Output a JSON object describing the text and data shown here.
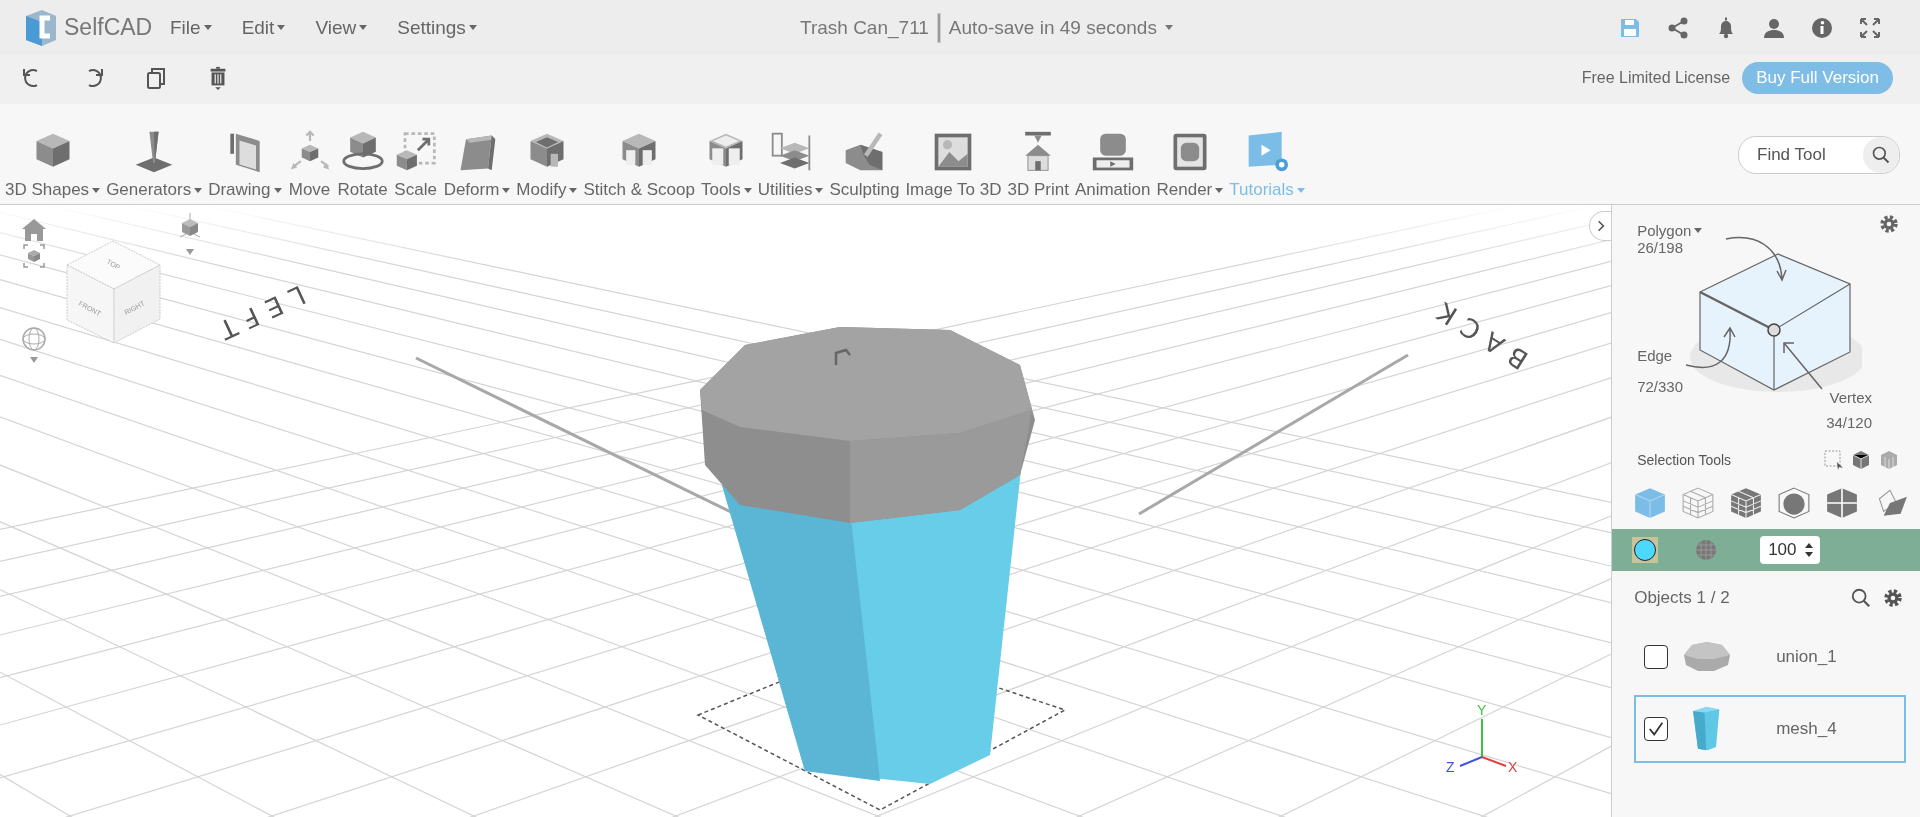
{
  "app": {
    "name": "SelfCAD"
  },
  "menus": [
    {
      "label": "File"
    },
    {
      "label": "Edit"
    },
    {
      "label": "View"
    },
    {
      "label": "Settings"
    }
  ],
  "document": {
    "title": "Trash Can_711",
    "autosave": "Auto-save in 49 seconds"
  },
  "license": {
    "text": "Free Limited License",
    "button": "Buy Full Version"
  },
  "toolbar": [
    {
      "label": "3D Shapes",
      "kind": "cube",
      "has_menu": true,
      "highlighted": false
    },
    {
      "label": "Generators",
      "kind": "cone",
      "has_menu": true,
      "highlighted": false
    },
    {
      "label": "Drawing",
      "kind": "drawing",
      "has_menu": true,
      "highlighted": false
    },
    {
      "label": "Move",
      "kind": "move",
      "has_menu": false,
      "highlighted": false
    },
    {
      "label": "Rotate",
      "kind": "rotate",
      "has_menu": false,
      "highlighted": false
    },
    {
      "label": "Scale",
      "kind": "scale",
      "has_menu": false,
      "highlighted": false
    },
    {
      "label": "Deform",
      "kind": "deform",
      "has_menu": true,
      "highlighted": false
    },
    {
      "label": "Modify",
      "kind": "modify",
      "has_menu": true,
      "highlighted": false
    },
    {
      "label": "Stitch & Scoop",
      "kind": "stitch",
      "has_menu": false,
      "highlighted": false
    },
    {
      "label": "Tools",
      "kind": "tools",
      "has_menu": true,
      "highlighted": false
    },
    {
      "label": "Utilities",
      "kind": "layers",
      "has_menu": true,
      "highlighted": false
    },
    {
      "label": "Sculpting",
      "kind": "sculpt",
      "has_menu": false,
      "highlighted": false
    },
    {
      "label": "Image To 3D",
      "kind": "image",
      "has_menu": false,
      "highlighted": false
    },
    {
      "label": "3D Print",
      "kind": "print",
      "has_menu": false,
      "highlighted": false
    },
    {
      "label": "Animation",
      "kind": "film",
      "has_menu": false,
      "highlighted": false
    },
    {
      "label": "Render",
      "kind": "render",
      "has_menu": true,
      "highlighted": false
    },
    {
      "label": "Tutorials",
      "kind": "video",
      "has_menu": true,
      "highlighted": true
    }
  ],
  "find_tool": {
    "placeholder": "Find Tool"
  },
  "viewport": {
    "view_cube": [
      "TOP",
      "FRONT",
      "RIGHT"
    ],
    "scene_labels": [
      "LEFT",
      "BACK"
    ],
    "axes": [
      "Y",
      "X",
      "Z"
    ]
  },
  "selection_panel": {
    "polygon": {
      "label": "Polygon",
      "count": "26/198"
    },
    "edge": {
      "label": "Edge",
      "count": "72/330"
    },
    "vertex": {
      "label": "Vertex",
      "count": "34/120"
    },
    "tools_label": "Selection Tools",
    "modes": [
      {
        "kind": "solid",
        "selected": true
      },
      {
        "kind": "wire",
        "selected": false
      },
      {
        "kind": "grid",
        "selected": false
      },
      {
        "kind": "sphere",
        "selected": false
      },
      {
        "kind": "split",
        "selected": false
      },
      {
        "kind": "plane",
        "selected": false
      }
    ]
  },
  "material": {
    "color": "#4dd9ff",
    "opacity": "100"
  },
  "objects": {
    "title": "Objects 1 / 2",
    "items": [
      {
        "name": "union_1",
        "kind": "lid",
        "checked": false,
        "selected": false
      },
      {
        "name": "mesh_4",
        "kind": "can",
        "checked": true,
        "selected": true
      }
    ]
  }
}
